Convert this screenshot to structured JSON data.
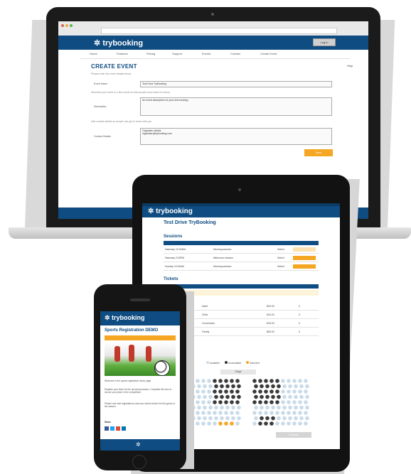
{
  "laptop": {
    "brand": "trybooking",
    "login_label": "Log in",
    "nav": [
      "Home",
      "Features",
      "Pricing",
      "Support",
      "Events",
      "Contact",
      "Create Event"
    ],
    "page_title": "CREATE EVENT",
    "help_label": "Help",
    "hint1": "Please enter the event details below",
    "hint2": "Describe your event in a few words so that people know what it is about",
    "hint3": "Add contact details so people can get in touch with you",
    "fields": [
      {
        "label": "Event Name",
        "value": "Test Drive TryBooking"
      },
      {
        "label": "Description",
        "value": "An event description for your test booking"
      },
      {
        "label": "Contact Details",
        "value": "Organiser details\norganiser@trybooking.com"
      }
    ],
    "next_label": "Next"
  },
  "tablet": {
    "brand": "trybooking",
    "event_title": "Test Drive TryBooking",
    "sessions_title": "Sessions",
    "sessions": [
      {
        "date": "Saturday 10:00AM",
        "desc": "Morning session",
        "status": "Select"
      },
      {
        "date": "Saturday 2:00PM",
        "desc": "Afternoon session",
        "status": "Select"
      },
      {
        "date": "Sunday 10:00AM",
        "desc": "Morning session",
        "status": "Select"
      }
    ],
    "tickets_title": "Tickets",
    "tickets": [
      {
        "name": "Adult",
        "price": "$20.00",
        "qty": "0"
      },
      {
        "name": "Child",
        "price": "$10.00",
        "qty": "0"
      },
      {
        "name": "Concession",
        "price": "$15.00",
        "qty": "0"
      },
      {
        "name": "Family",
        "price": "$50.00",
        "qty": "0"
      }
    ],
    "legend": [
      "Available",
      "Unavailable",
      "Selected"
    ],
    "stage_label": "Stage",
    "continue_label": "Continue"
  },
  "phone": {
    "brand": "trybooking",
    "title": "Sports Registration DEMO",
    "para1": "Welcome to the sports registration demo page.",
    "para2": "Register your team for the upcoming season. Complete the form to secure your place in the competition.",
    "para3": "Please note that registrations close two weeks before the first game of the season.",
    "share_label": "Share"
  },
  "colors": {
    "brand_blue": "#0f4c81",
    "accent_orange": "#f5a623"
  }
}
